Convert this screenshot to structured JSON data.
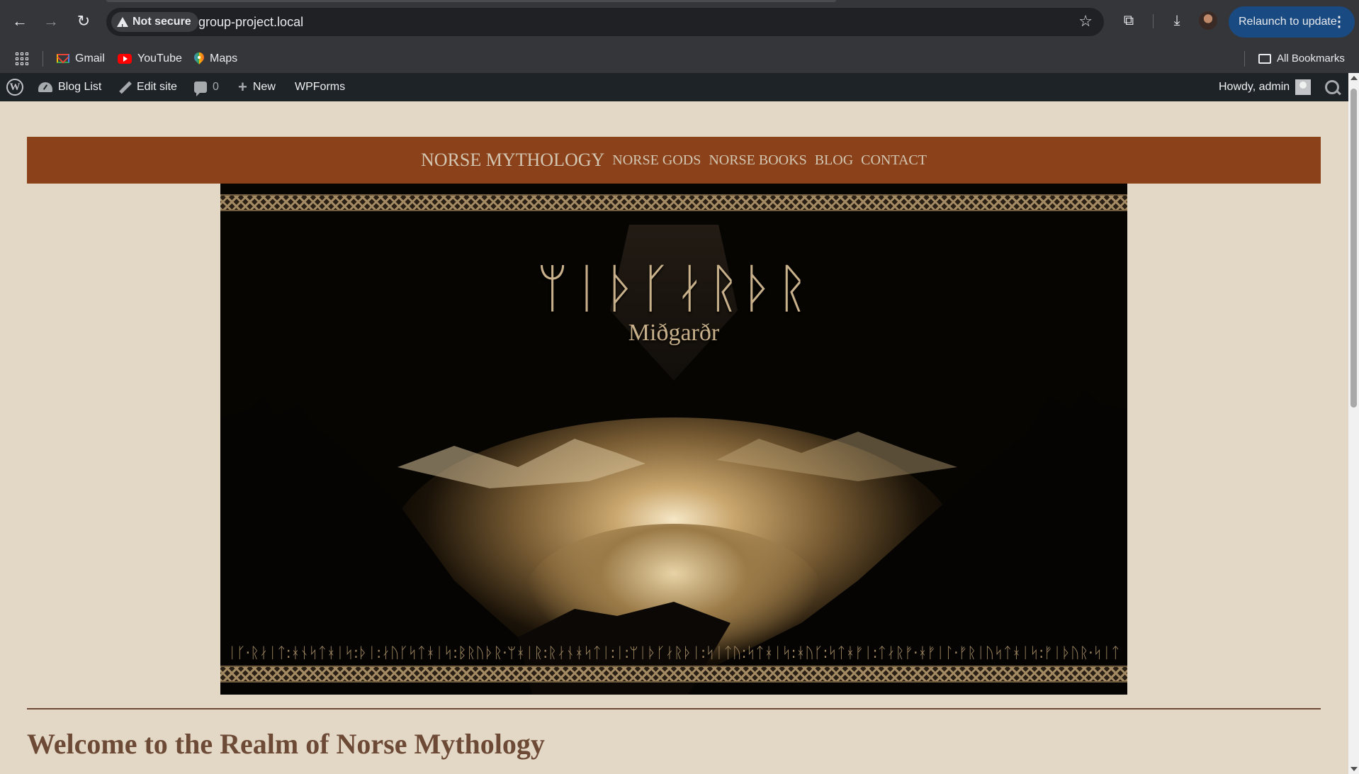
{
  "browser": {
    "security_label": "Not secure",
    "url": "group-project.local",
    "relaunch_label": "Relaunch to update"
  },
  "bookmarks": {
    "items": [
      {
        "label": "Gmail",
        "icon": "gmail-icon"
      },
      {
        "label": "YouTube",
        "icon": "youtube-icon"
      },
      {
        "label": "Maps",
        "icon": "maps-icon"
      }
    ],
    "all_label": "All Bookmarks"
  },
  "admin_bar": {
    "blog_list": "Blog List",
    "edit_site": "Edit site",
    "comments_count": "0",
    "new_label": "New",
    "wpforms": "WPForms",
    "howdy": "Howdy, admin"
  },
  "site": {
    "title": "NORSE MYTHOLOGY",
    "nav": [
      "NORSE GODS",
      "NORSE BOOKS",
      "BLOG",
      "CONTACT"
    ],
    "hero": {
      "runes": "ᛘᛁᚦᚴᛅᚱᚦᚱ",
      "subtitle": "Miðgarðr",
      "rune_strip": "ᛁᚴ·ᚱᛅᛁᛏ:ᚼᚾᛋᛏᚼᛁᛋ:ᚦᛁ:ᛅᚢᚴᛋᛏᚼᛁᛋ:ᛒᚱᚢᚦᚱ·ᛘᚼᛁᚱ:ᚱᛅᚾᚼᛋᛏᛁ:ᛁ:ᛘᛁᚦᚴᛅᚱᚦᛁ:ᛋᛁᛏᚢ:ᛋᛏᚼᛁᛋ:ᚼᚢᚴ:ᛋᛏᚼᚠᛁ:ᛏᛅᚱᚠ·ᚼᚠᛁᛚ·ᚠᚱᛁᚢᛋᛏᚼᛁᛋ:ᚠᛁᚦᚢᚱ·ᛋᛁᛏ"
    },
    "heading": "Welcome to the Realm of Norse Mythology"
  },
  "colors": {
    "page_bg": "#e3d8c6",
    "nav_bg": "#8b421a",
    "nav_text": "#d3c6b2",
    "heading": "#6d4a36",
    "admin_bar": "#1d2327",
    "chrome": "#35363a"
  }
}
